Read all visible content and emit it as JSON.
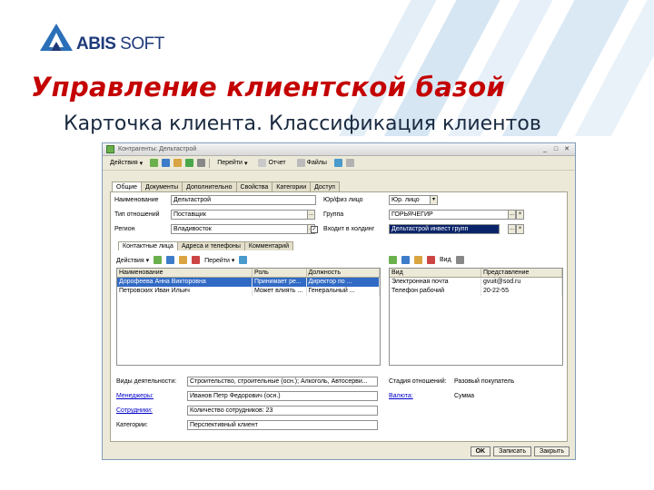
{
  "brand": {
    "logo_bold": "ABIS",
    "logo_light": " SOFT"
  },
  "slide": {
    "title": "Управление клиентской базой",
    "subtitle": "Карточка клиента. Классификация клиентов"
  },
  "window": {
    "title": "Контрагенты: Дельтастрой",
    "toolbar": {
      "actions": "Действия",
      "goto": "Перейти",
      "report": "Отчет",
      "files": "Файлы"
    },
    "tabs": [
      "Общие",
      "Документы",
      "Дополнительно",
      "Свойства",
      "Категории",
      "Доступ"
    ],
    "fields": {
      "name_label": "Наименование",
      "name_value": "Дельтастрой",
      "relation_label": "Тип отношений",
      "relation_value": "Поставщик",
      "region_label": "Регион",
      "region_value": "Владивосток",
      "legal_label": "Юр/физ лицо",
      "legal_value": "Юр. лицо",
      "group_label": "Группа",
      "group_value": "ГОРЬЯЧЕГИР",
      "holding_label": "Входит в холдинг",
      "holding_value": "Дельтастрой инвест групп"
    },
    "subtabs": [
      "Контактные лица",
      "Адреса и телефоны",
      "Комментарий"
    ],
    "contacts_toolbar": {
      "actions": "Действия",
      "goto": "Перейти"
    },
    "contacts_headers": [
      "Наименование",
      "Роль",
      "Должность"
    ],
    "contacts": [
      {
        "name": "Дорофеева Анна Викторовна",
        "role": "Принимает ре...",
        "position": "Директор по ..."
      },
      {
        "name": "Петровских Иван Ильич",
        "role": "Может влиять ...",
        "position": "Генеральный ..."
      }
    ],
    "phones_toolbar": {
      "view": "Вид"
    },
    "phones_headers": [
      "Вид",
      "Представление"
    ],
    "phones": [
      {
        "kind": "Электронная почта",
        "value": "gvuit@sod.ru"
      },
      {
        "kind": "Телефон рабочий",
        "value": "20-22-55"
      }
    ],
    "bottom": {
      "activity_label": "Виды деятельности:",
      "activity_value": "Строительство, строительные (осн.); Алкоголь, Автосерви...",
      "stage_label": "Стадия отношений:",
      "stage_value": "Разовый покупатель",
      "manager_label": "Менеджеры:",
      "manager_value": "Иванов Петр Федорович (осн.)",
      "currency_label": "Валюта:",
      "currency_value": "Сумма",
      "staff_label": "Сотрудники:",
      "staff_value": "Количество сотрудников: 23",
      "category_label": "Категории:",
      "category_value": "Перспективный клиент"
    },
    "buttons": {
      "ok": "OK",
      "write": "Записать",
      "close": "Закрыть"
    }
  },
  "colors": {
    "accent_red": "#c40000",
    "brand_blue": "#1e3a7a",
    "selection": "#316ac5"
  }
}
